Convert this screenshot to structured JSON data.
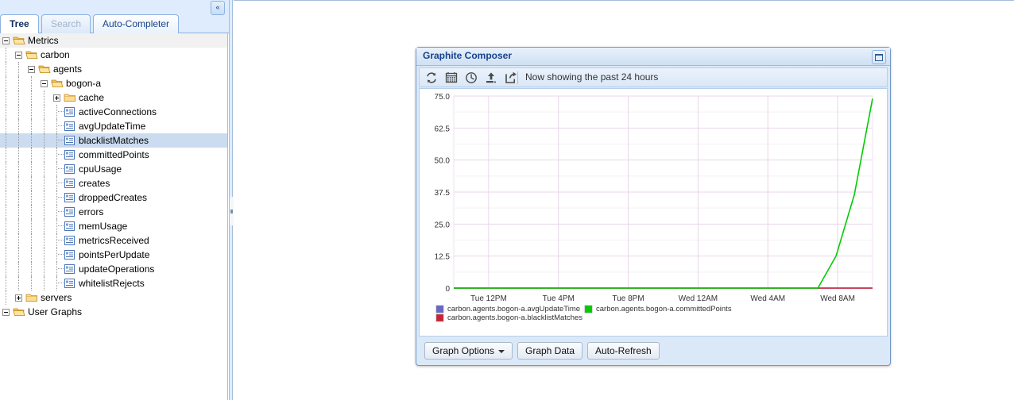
{
  "sidebar": {
    "collapse_button": "«",
    "tabs": [
      {
        "label": "Tree",
        "state": "active"
      },
      {
        "label": "Search",
        "state": "disabled"
      },
      {
        "label": "Auto-Completer",
        "state": "normal"
      }
    ],
    "tree": [
      {
        "label": "Metrics",
        "depth": 0,
        "type": "folder",
        "expander": "minus",
        "selected": false,
        "shaded": true
      },
      {
        "label": "carbon",
        "depth": 1,
        "type": "folder",
        "expander": "minus",
        "selected": false,
        "shaded": false
      },
      {
        "label": "agents",
        "depth": 2,
        "type": "folder",
        "expander": "minus",
        "selected": false,
        "shaded": false
      },
      {
        "label": "bogon-a",
        "depth": 3,
        "type": "folder",
        "expander": "minus",
        "selected": false,
        "shaded": false
      },
      {
        "label": "cache",
        "depth": 4,
        "type": "folder",
        "expander": "plus",
        "selected": false,
        "shaded": false
      },
      {
        "label": "activeConnections",
        "depth": 4,
        "type": "leaf",
        "expander": "none",
        "selected": false,
        "shaded": false
      },
      {
        "label": "avgUpdateTime",
        "depth": 4,
        "type": "leaf",
        "expander": "none",
        "selected": false,
        "shaded": false
      },
      {
        "label": "blacklistMatches",
        "depth": 4,
        "type": "leaf",
        "expander": "none",
        "selected": true,
        "shaded": false
      },
      {
        "label": "committedPoints",
        "depth": 4,
        "type": "leaf",
        "expander": "none",
        "selected": false,
        "shaded": false
      },
      {
        "label": "cpuUsage",
        "depth": 4,
        "type": "leaf",
        "expander": "none",
        "selected": false,
        "shaded": false
      },
      {
        "label": "creates",
        "depth": 4,
        "type": "leaf",
        "expander": "none",
        "selected": false,
        "shaded": false
      },
      {
        "label": "droppedCreates",
        "depth": 4,
        "type": "leaf",
        "expander": "none",
        "selected": false,
        "shaded": false
      },
      {
        "label": "errors",
        "depth": 4,
        "type": "leaf",
        "expander": "none",
        "selected": false,
        "shaded": false
      },
      {
        "label": "memUsage",
        "depth": 4,
        "type": "leaf",
        "expander": "none",
        "selected": false,
        "shaded": false
      },
      {
        "label": "metricsReceived",
        "depth": 4,
        "type": "leaf",
        "expander": "none",
        "selected": false,
        "shaded": false
      },
      {
        "label": "pointsPerUpdate",
        "depth": 4,
        "type": "leaf",
        "expander": "none",
        "selected": false,
        "shaded": false
      },
      {
        "label": "updateOperations",
        "depth": 4,
        "type": "leaf",
        "expander": "none",
        "selected": false,
        "shaded": false
      },
      {
        "label": "whitelistRejects",
        "depth": 4,
        "type": "leaf",
        "expander": "none",
        "selected": false,
        "shaded": false
      },
      {
        "label": "servers",
        "depth": 1,
        "type": "folder",
        "expander": "plus",
        "selected": false,
        "shaded": false
      },
      {
        "label": "User Graphs",
        "depth": 0,
        "type": "folder",
        "expander": "minus",
        "selected": false,
        "shaded": false
      }
    ]
  },
  "composer": {
    "title": "Graphite Composer",
    "restore_button": "restore",
    "toolbar": {
      "icons": [
        {
          "name": "refresh-icon",
          "label": "Refresh"
        },
        {
          "name": "calendar-icon",
          "label": "Date Range"
        },
        {
          "name": "clock-icon",
          "label": "Recent Data"
        },
        {
          "name": "upload-icon",
          "label": "Save to My Graphs"
        },
        {
          "name": "share-icon",
          "label": "Share / Export"
        }
      ],
      "status": "Now showing the past 24 hours"
    },
    "buttons": [
      {
        "label": "Graph Options",
        "caret": true
      },
      {
        "label": "Graph Data",
        "caret": false
      },
      {
        "label": "Auto-Refresh",
        "caret": false
      }
    ]
  },
  "chart_data": {
    "type": "line",
    "title": "",
    "xlabel": "",
    "ylabel": "",
    "ylim": [
      0,
      75
    ],
    "yticks": [
      "0",
      "12.5",
      "25.0",
      "37.5",
      "50.0",
      "62.5",
      "75.0"
    ],
    "ytick_values": [
      0,
      12.5,
      25,
      37.5,
      50,
      62.5,
      75
    ],
    "xticks": [
      "Tue 12PM",
      "Tue 4PM",
      "Tue 8PM",
      "Wed 12AM",
      "Wed 4AM",
      "Wed 8AM"
    ],
    "grid": true,
    "grid_color": "#e8d6e8",
    "legend_position": "bottom",
    "series": [
      {
        "name": "carbon.agents.bogon-a.avgUpdateTime",
        "color": "#6666cc",
        "values": [
          0,
          0,
          0,
          0,
          0,
          0,
          0,
          0,
          0,
          0,
          0,
          0,
          0,
          0,
          0,
          0,
          0,
          0,
          0,
          0,
          0,
          0,
          0,
          0
        ]
      },
      {
        "name": "carbon.agents.bogon-a.blacklistMatches",
        "color": "#cc2233",
        "values": [
          0,
          0,
          0,
          0,
          0,
          0,
          0,
          0,
          0,
          0,
          0,
          0,
          0,
          0,
          0,
          0,
          0,
          0,
          0,
          0,
          0,
          0,
          0,
          0
        ]
      },
      {
        "name": "carbon.agents.bogon-a.committedPoints",
        "color": "#00cc00",
        "values": [
          0,
          0,
          0,
          0,
          0,
          0,
          0,
          0,
          0,
          0,
          0,
          0,
          0,
          0,
          0,
          0,
          0,
          0,
          0,
          0,
          0,
          12.6,
          36.5,
          74
        ]
      }
    ]
  }
}
